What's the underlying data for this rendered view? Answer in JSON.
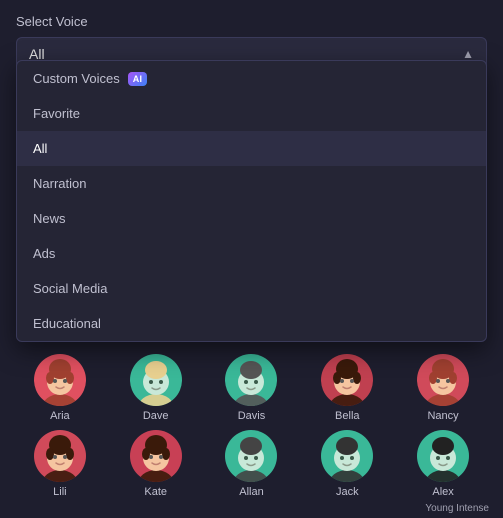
{
  "header": {
    "label": "Select Voice"
  },
  "dropdown": {
    "selected": "All",
    "chevron": "▲",
    "items": [
      {
        "id": "custom-voices",
        "label": "Custom Voices",
        "hasBadge": true,
        "badgeText": "AI",
        "isActive": false
      },
      {
        "id": "favorite",
        "label": "Favorite",
        "hasBadge": false,
        "isActive": false
      },
      {
        "id": "all",
        "label": "All",
        "hasBadge": false,
        "isActive": true
      },
      {
        "id": "narration",
        "label": "Narration",
        "hasBadge": false,
        "isActive": false
      },
      {
        "id": "news",
        "label": "News",
        "hasBadge": false,
        "isActive": false
      },
      {
        "id": "ads",
        "label": "Ads",
        "hasBadge": false,
        "isActive": false
      },
      {
        "id": "social-media",
        "label": "Social Media",
        "hasBadge": false,
        "isActive": false
      },
      {
        "id": "educational",
        "label": "Educational",
        "hasBadge": false,
        "isActive": false
      }
    ]
  },
  "voices": {
    "row1": [
      {
        "id": "aria",
        "name": "Aria",
        "avatarClass": "avatar-aria",
        "gender": "female"
      },
      {
        "id": "dave",
        "name": "Dave",
        "avatarClass": "avatar-dave",
        "gender": "male"
      },
      {
        "id": "davis",
        "name": "Davis",
        "avatarClass": "avatar-davis",
        "gender": "male"
      },
      {
        "id": "bella",
        "name": "Bella",
        "avatarClass": "avatar-bella",
        "gender": "female"
      },
      {
        "id": "nancy",
        "name": "Nancy",
        "avatarClass": "avatar-nancy",
        "gender": "female"
      }
    ],
    "row2": [
      {
        "id": "lili",
        "name": "Lili",
        "avatarClass": "avatar-lili",
        "gender": "female"
      },
      {
        "id": "kate",
        "name": "Kate",
        "avatarClass": "avatar-kate",
        "gender": "female"
      },
      {
        "id": "allan",
        "name": "Allan",
        "avatarClass": "avatar-allan",
        "gender": "male"
      },
      {
        "id": "jack",
        "name": "Jack",
        "avatarClass": "avatar-jack",
        "gender": "male"
      },
      {
        "id": "alex",
        "name": "Alex",
        "avatarClass": "avatar-alex",
        "gender": "male"
      }
    ]
  },
  "status": {
    "text": "Young Intense"
  }
}
